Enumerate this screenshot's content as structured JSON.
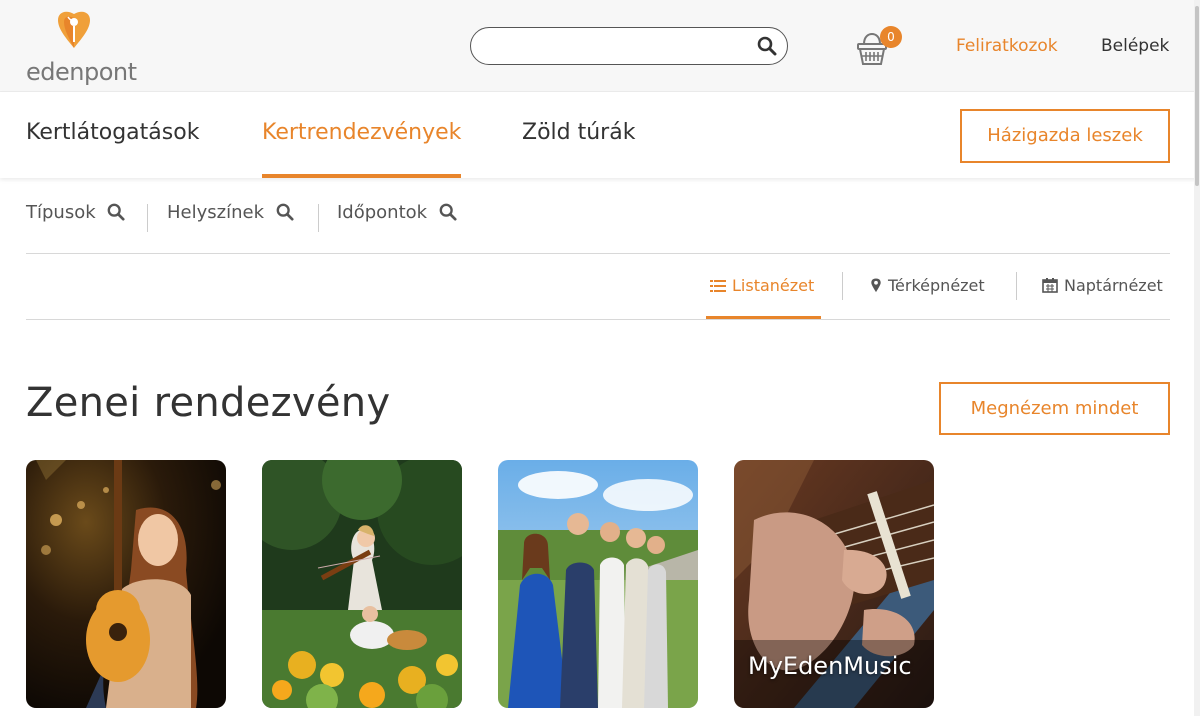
{
  "header": {
    "logo_text": "edenpont",
    "search": {
      "value": "",
      "placeholder": ""
    },
    "cart_count": "0",
    "subscribe_label": "Feliratkozok",
    "login_label": "Belépek"
  },
  "nav": {
    "items": [
      {
        "label": "Kertlátogatások",
        "active": false
      },
      {
        "label": "Kertrendezvények",
        "active": true
      },
      {
        "label": "Zöld túrák",
        "active": false
      }
    ],
    "host_button": "Házigazda leszek"
  },
  "filters": [
    {
      "label": "Típusok"
    },
    {
      "label": "Helyszínek"
    },
    {
      "label": "Időpontok"
    }
  ],
  "views": [
    {
      "label": "Listanézet",
      "icon": "list-icon",
      "active": true
    },
    {
      "label": "Térképnézet",
      "icon": "map-pin-icon",
      "active": false
    },
    {
      "label": "Naptárnézet",
      "icon": "calendar-icon",
      "active": false
    }
  ],
  "section": {
    "title": "Zenei rendezvény",
    "view_all_label": "Megnézem mindet",
    "cards": [
      {
        "caption": ""
      },
      {
        "caption": ""
      },
      {
        "caption": ""
      },
      {
        "caption": "MyEdenMusic"
      }
    ]
  },
  "colors": {
    "accent": "#e8852b",
    "text": "#333333",
    "topbar_bg": "#f7f7f7"
  }
}
